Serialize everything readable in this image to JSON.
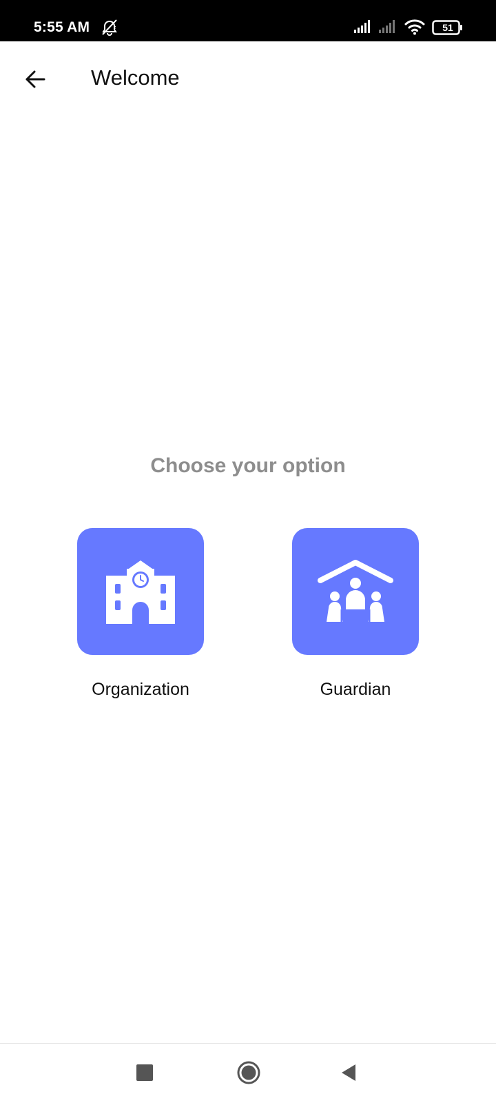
{
  "status_bar": {
    "time": "5:55 AM",
    "battery_level": "51",
    "icons": [
      "silent-alarm-icon",
      "signal-icon",
      "signal-icon",
      "wifi-icon",
      "battery-icon"
    ]
  },
  "app_bar": {
    "back_icon": "arrow-left-icon",
    "title": "Welcome"
  },
  "main": {
    "heading": "Choose your option",
    "options": [
      {
        "label": "Organization",
        "icon": "school-building-icon"
      },
      {
        "label": "Guardian",
        "icon": "family-home-icon"
      }
    ]
  },
  "nav_bar": {
    "icons": [
      "recents-square-icon",
      "home-circle-icon",
      "back-triangle-icon"
    ]
  },
  "colors": {
    "status_bar_bg": "#000000",
    "tile_accent": "#6679ff",
    "heading_text": "#8d8d8d",
    "body_text": "#111111",
    "background": "#ffffff"
  }
}
